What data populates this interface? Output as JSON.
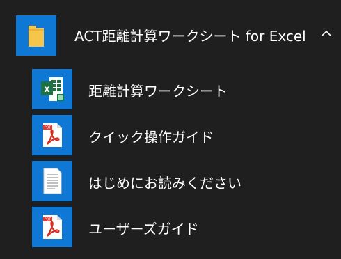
{
  "start_menu_group": {
    "title": "ACT距離計算ワークシート for Excel",
    "expanded": true,
    "chevron_icon": "chevron-up-icon",
    "folder_icon": "folder-icon",
    "accent_color": "#0f78d4",
    "items": [
      {
        "label": "距離計算ワークシート",
        "icon": "excel-icon"
      },
      {
        "label": "クイック操作ガイド",
        "icon": "pdf-icon"
      },
      {
        "label": "はじめにお読みください",
        "icon": "text-document-icon"
      },
      {
        "label": "ユーザーズガイド",
        "icon": "pdf-icon"
      }
    ]
  }
}
